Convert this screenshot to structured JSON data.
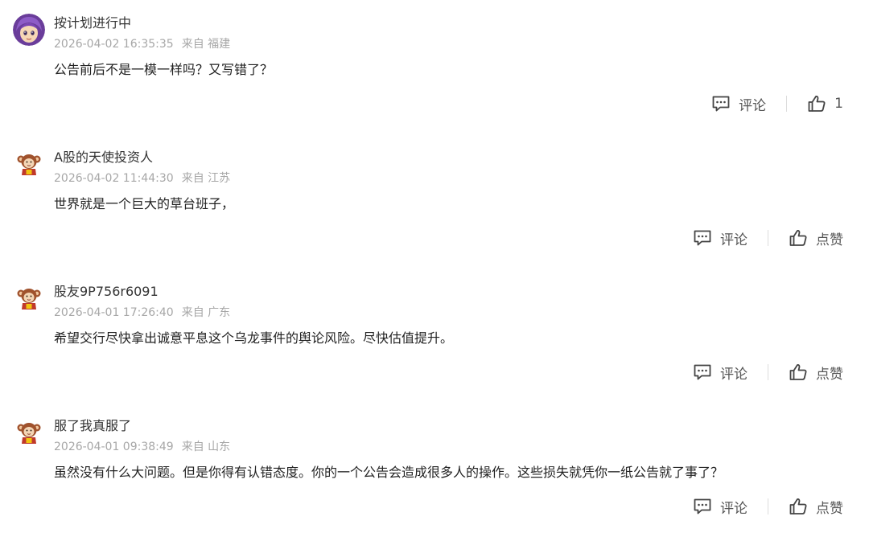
{
  "comments": [
    {
      "avatar": "purple-haired-girl-avatar",
      "user": "按计划进行中",
      "time": "2026-04-02 16:35:35",
      "location": "来自 福建",
      "content": "公告前后不是一模一样吗？又写错了？",
      "comment_label": "评论",
      "like_label": "1"
    },
    {
      "avatar": "monkey-avatar",
      "user": "A股的天使投资人",
      "time": "2026-04-02 11:44:30",
      "location": "来自 江苏",
      "content": "世界就是一个巨大的草台班子，",
      "comment_label": "评论",
      "like_label": "点赞"
    },
    {
      "avatar": "monkey-avatar",
      "user": "股友9P756r6091",
      "time": "2026-04-01 17:26:40",
      "location": "来自 广东",
      "content": "希望交行尽快拿出诚意平息这个乌龙事件的舆论风险。尽快估值提升。",
      "comment_label": "评论",
      "like_label": "点赞"
    },
    {
      "avatar": "monkey-avatar",
      "user": "服了我真服了",
      "time": "2026-04-01 09:38:49",
      "location": "来自 山东",
      "content": "虽然没有什么大问题。但是你得有认错态度。你的一个公告会造成很多人的操作。这些损失就凭你一纸公告就了事了？",
      "comment_label": "评论",
      "like_label": "点赞"
    }
  ],
  "colors": {
    "meta_text": "#a7a7a7",
    "action_text": "#555555",
    "separator": "#dcdcdc"
  }
}
